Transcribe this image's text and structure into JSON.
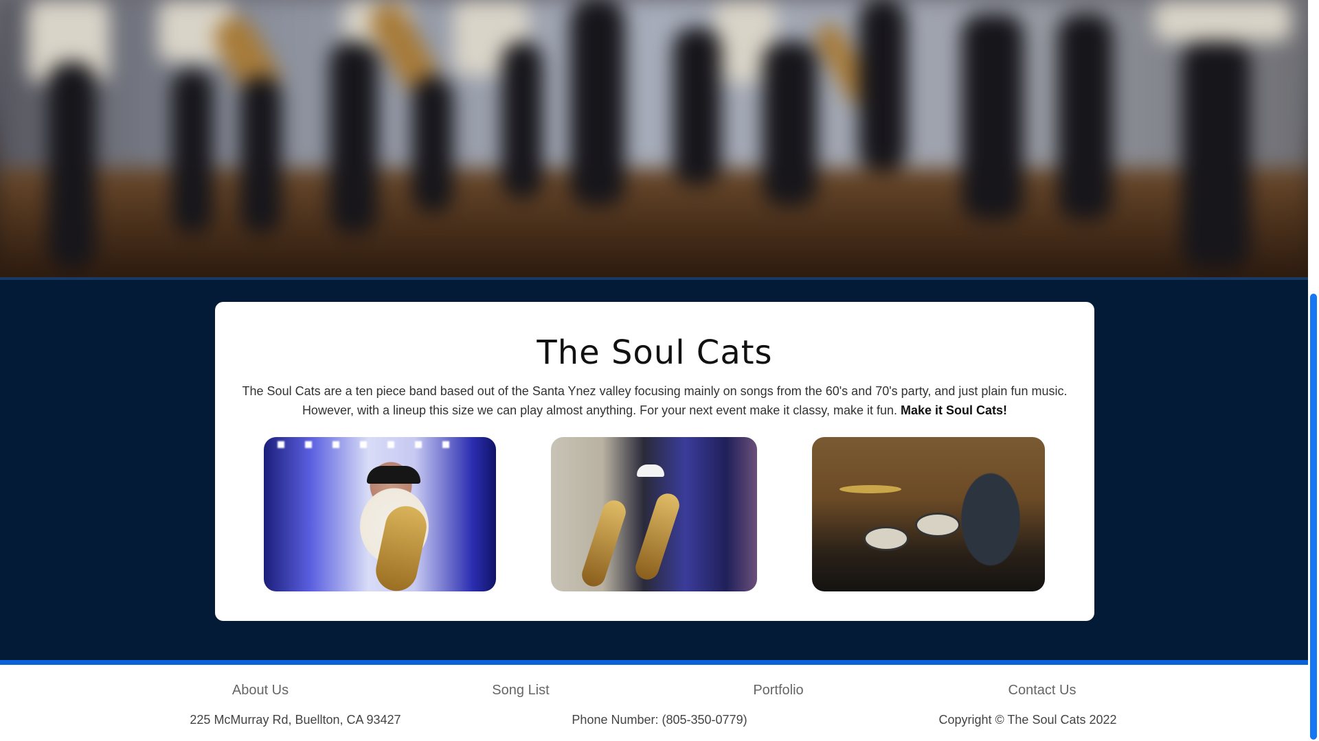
{
  "main": {
    "title": "The Soul Cats",
    "description": "The Soul Cats are a ten piece band based out of the Santa Ynez valley focusing mainly on songs from the 60's and 70's party, and just plain fun music. However, with a lineup this size we can play almost anything. For your next event make it classy, make it fun.",
    "tagline": "Make it Soul Cats!"
  },
  "footer": {
    "nav": {
      "about": "About Us",
      "songs": "Song List",
      "portfolio": "Portfolio",
      "contact": "Contact Us"
    },
    "address": "225 McMurray Rd, Buellton, CA 93427",
    "phone": "Phone Number: (805-350-0779)",
    "copyright": "Copyright © The Soul Cats 2022"
  },
  "colors": {
    "page_background": "#031b36",
    "footer_accent": "#0a63d6",
    "scroll_thumb": "#1677f2"
  }
}
